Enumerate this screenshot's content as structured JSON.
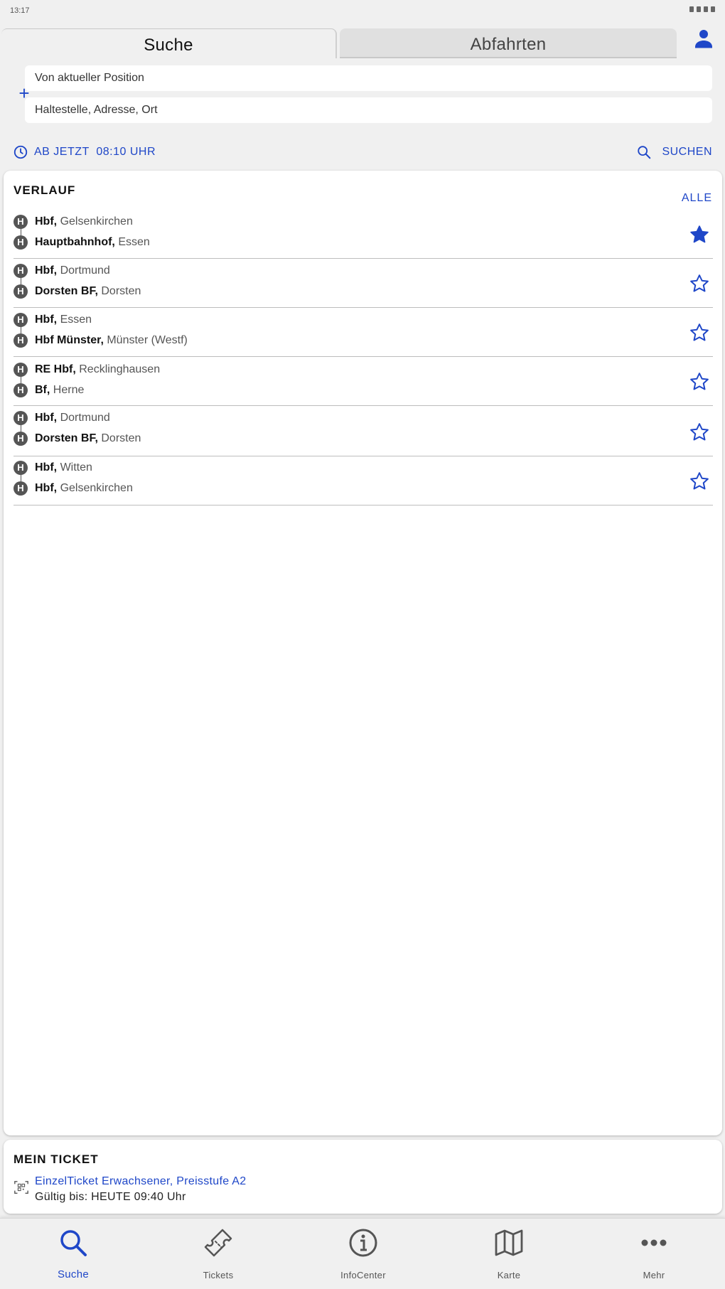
{
  "status_bar": {
    "time": "13:17"
  },
  "tabs": {
    "search": "Suche",
    "departures": "Abfahrten"
  },
  "search_form": {
    "from_value": "Von aktueller Position",
    "to_placeholder": "Haltestelle, Adresse, Ort",
    "time_label": "AB JETZT  08:10 UHR",
    "search_label": "SUCHEN"
  },
  "history": {
    "title": "VERLAUF",
    "all_label": "ALLE",
    "items": [
      {
        "from_bold": "Hbf,",
        "from_city": "Gelsenkirchen",
        "to_bold": "Hauptbahnhof,",
        "to_city": "Essen",
        "favorite": true
      },
      {
        "from_bold": "Hbf,",
        "from_city": "Dortmund",
        "to_bold": "Dorsten BF,",
        "to_city": "Dorsten",
        "favorite": false
      },
      {
        "from_bold": "Hbf,",
        "from_city": "Essen",
        "to_bold": "Hbf Münster,",
        "to_city": "Münster (Westf)",
        "favorite": false
      },
      {
        "from_bold": "RE Hbf,",
        "from_city": "Recklinghausen",
        "to_bold": "Bf,",
        "to_city": "Herne",
        "favorite": false
      },
      {
        "from_bold": "Hbf,",
        "from_city": "Dortmund",
        "to_bold": "Dorsten BF,",
        "to_city": "Dorsten",
        "favorite": false
      },
      {
        "from_bold": "Hbf,",
        "from_city": "Witten",
        "to_bold": "Hbf,",
        "to_city": "Gelsenkirchen",
        "favorite": false
      }
    ],
    "stop_badge": "H"
  },
  "ticket": {
    "title": "MEIN TICKET",
    "name": "EinzelTicket Erwachsener, Preisstufe A2",
    "valid": "Gültig bis: HEUTE 09:40 Uhr"
  },
  "bottom_nav": {
    "items": [
      {
        "label": "Suche",
        "icon": "search-icon"
      },
      {
        "label": "Tickets",
        "icon": "ticket-icon"
      },
      {
        "label": "InfoCenter",
        "icon": "info-icon"
      },
      {
        "label": "Karte",
        "icon": "map-icon"
      },
      {
        "label": "Mehr",
        "icon": "more-icon"
      }
    ]
  },
  "colors": {
    "accent": "#1f47c8",
    "background": "#f0f0f0",
    "badge": "#555555"
  }
}
